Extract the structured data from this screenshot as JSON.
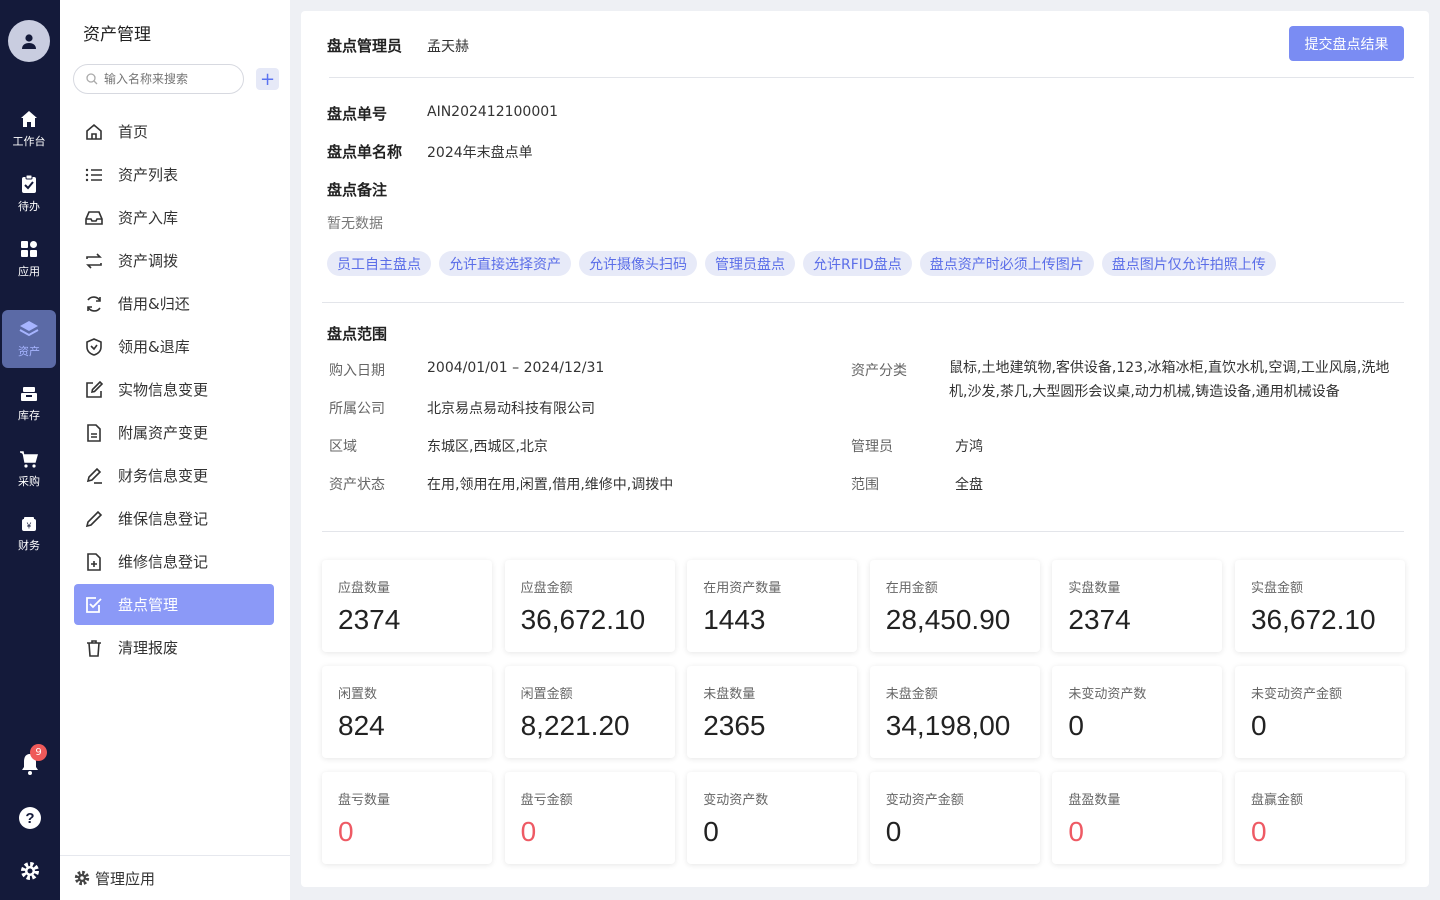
{
  "rail": {
    "items": [
      {
        "label": "工作台",
        "icon": "home-icon"
      },
      {
        "label": "待办",
        "icon": "clipboard-icon"
      },
      {
        "label": "应用",
        "icon": "apps-icon"
      },
      {
        "label": "资产",
        "icon": "layers-icon"
      },
      {
        "label": "库存",
        "icon": "inventory-icon"
      },
      {
        "label": "采购",
        "icon": "cart-icon"
      },
      {
        "label": "财务",
        "icon": "finance-icon"
      }
    ],
    "notification_count": "9"
  },
  "subnav": {
    "title": "资产管理",
    "search_placeholder": "输入名称来搜索",
    "add_label": "+",
    "items": [
      {
        "label": "首页"
      },
      {
        "label": "资产列表"
      },
      {
        "label": "资产入库"
      },
      {
        "label": "资产调拨"
      },
      {
        "label": "借用&归还"
      },
      {
        "label": "领用&退库"
      },
      {
        "label": "实物信息变更"
      },
      {
        "label": "附属资产变更"
      },
      {
        "label": "财务信息变更"
      },
      {
        "label": "维保信息登记"
      },
      {
        "label": "维修信息登记"
      },
      {
        "label": "盘点管理"
      },
      {
        "label": "清理报废"
      }
    ],
    "footer_label": "管理应用"
  },
  "main": {
    "manager_label": "盘点管理员",
    "manager_value": "孟天赫",
    "submit_label": "提交盘点结果",
    "order_no_label": "盘点单号",
    "order_no_value": "AIN202412100001",
    "order_name_label": "盘点单名称",
    "order_name_value": "2024年末盘点单",
    "remark_label": "盘点备注",
    "remark_value": "暂无数据",
    "tags": [
      "员工自主盘点",
      "允许直接选择资产",
      "允许摄像头扫码",
      "管理员盘点",
      "允许RFID盘点",
      "盘点资产时必须上传图片",
      "盘点图片仅允许拍照上传"
    ],
    "scope_title": "盘点范围",
    "scope": {
      "purchase_date_label": "购入日期",
      "purchase_date_value": "2004/01/01 – 2024/12/31",
      "company_label": "所属公司",
      "company_value": "北京易点易动科技有限公司",
      "area_label": "区域",
      "area_value": "东城区,西城区,北京",
      "status_label": "资产状态",
      "status_value": "在用,领用在用,闲置,借用,维修中,调拨中",
      "category_label": "资产分类",
      "category_value": "鼠标,土地建筑物,客供设备,123,冰箱冰柜,直饮水机,空调,工业风扇,洗地机,沙发,茶几,大型圆形会议桌,动力机械,铸造设备,通用机械设备",
      "admin_label": "管理员",
      "admin_value": "方鸿",
      "range_label": "范围",
      "range_value": "全盘"
    },
    "stats": [
      {
        "label": "应盘数量",
        "value": "2374"
      },
      {
        "label": "应盘金额",
        "value": "36,672.10"
      },
      {
        "label": "在用资产数量",
        "value": "1443"
      },
      {
        "label": "在用金额",
        "value": "28,450.90"
      },
      {
        "label": "实盘数量",
        "value": "2374"
      },
      {
        "label": "实盘金额",
        "value": "36,672.10"
      },
      {
        "label": "闲置数",
        "value": "824"
      },
      {
        "label": "闲置金额",
        "value": "8,221.20"
      },
      {
        "label": "未盘数量",
        "value": "2365"
      },
      {
        "label": "未盘金额",
        "value": "34,198,00"
      },
      {
        "label": "未变动资产数",
        "value": "0"
      },
      {
        "label": "未变动资产金额",
        "value": "0"
      },
      {
        "label": "盘亏数量",
        "value": "0"
      },
      {
        "label": "盘亏金额",
        "value": "0"
      },
      {
        "label": "变动资产数",
        "value": "0"
      },
      {
        "label": "变动资产金额",
        "value": "0"
      },
      {
        "label": "盘盈数量",
        "value": "0"
      },
      {
        "label": "盘赢金额",
        "value": "0"
      }
    ]
  },
  "colors": {
    "rail_bg": "#141a3a",
    "accent": "#7a8cf3",
    "active_nav": "#8b99f7",
    "danger": "#ee5a64",
    "tag_bg": "#e7eaf8",
    "tag_text": "#5b6ee8"
  }
}
